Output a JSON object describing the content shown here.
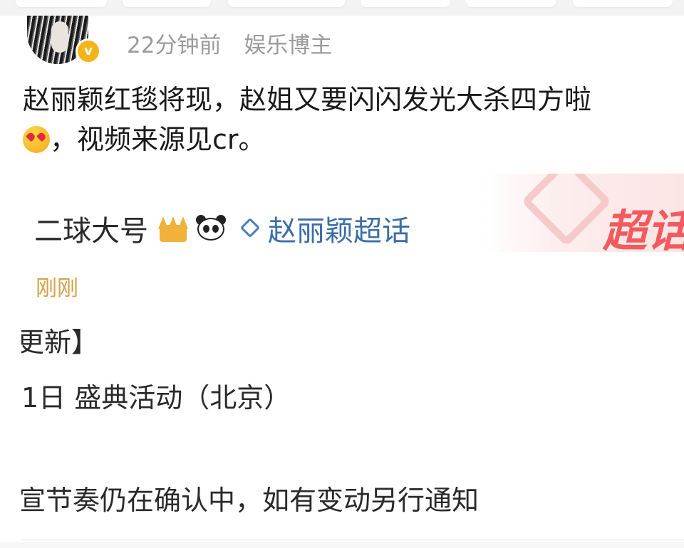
{
  "post": {
    "time": "22分钟前",
    "source_tag": "娱乐博主",
    "verified_badge": "v",
    "text_part1": "赵丽颖红毯将现，赵姐又要闪闪发光大杀四方啦",
    "text_part2": "，视频来源见cr。",
    "emoji_icon": "heart-eyes-emoji-icon"
  },
  "embedded": {
    "author": "二球大号",
    "topic": "赵丽颖超话",
    "watermark": "超话",
    "time": "刚刚",
    "line1": "更新】",
    "line2": "1日 盛典活动（北京）",
    "line3": "宣节奏仍在确认中，如有变动另行通知",
    "icons": [
      "crown-icon",
      "panda-icon",
      "gem-icon"
    ]
  },
  "colors": {
    "meta_gray": "#9b9b9b",
    "verify_gold": "#f3b519",
    "topic_blue": "#3d6ea8",
    "time_gold": "#d4a04a",
    "watermark_red": "#f25a5f"
  }
}
